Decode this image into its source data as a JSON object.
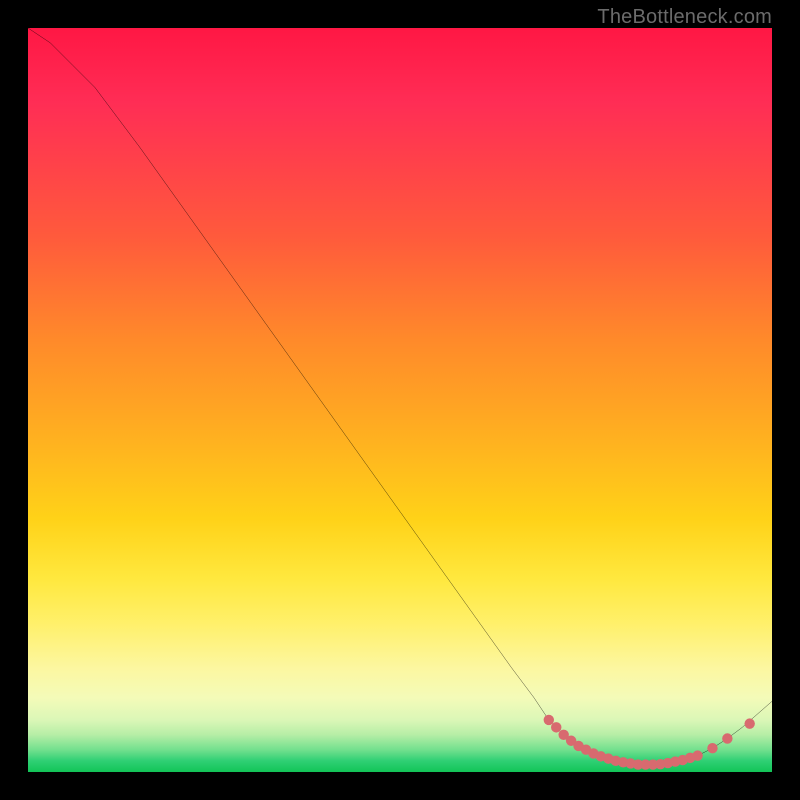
{
  "attribution": "TheBottleneck.com",
  "colors": {
    "frame": "#000000",
    "curve": "#000000",
    "marker": "#d86a6f",
    "gradient_top": "#ff1744",
    "gradient_bottom": "#12c457"
  },
  "chart_data": {
    "type": "line",
    "title": "",
    "xlabel": "",
    "ylabel": "",
    "xlim": [
      0,
      100
    ],
    "ylim": [
      0,
      100
    ],
    "grid": false,
    "legend": false,
    "series": [
      {
        "name": "bottleneck-curve",
        "x": [
          0,
          3,
          6,
          9,
          12,
          15,
          20,
          25,
          30,
          35,
          40,
          45,
          50,
          55,
          60,
          65,
          68,
          70,
          72,
          74,
          76,
          78,
          80,
          82,
          84,
          86,
          88,
          90,
          92,
          94,
          96,
          100
        ],
        "y": [
          100,
          98,
          95,
          92,
          88,
          84,
          77,
          70,
          63,
          56,
          49,
          42,
          35,
          28,
          21,
          14,
          10,
          7,
          5,
          3.5,
          2.5,
          1.8,
          1.3,
          1.0,
          1.0,
          1.2,
          1.6,
          2.2,
          3.2,
          4.5,
          6.0,
          9.5
        ]
      }
    ],
    "markers": {
      "name": "highlight-dots",
      "x": [
        70,
        71,
        72,
        73,
        74,
        75,
        76,
        77,
        78,
        79,
        80,
        81,
        82,
        83,
        84,
        85,
        86,
        87,
        88,
        89,
        90,
        92,
        94,
        97
      ],
      "y": [
        7.0,
        6.0,
        5.0,
        4.2,
        3.5,
        3.0,
        2.5,
        2.1,
        1.8,
        1.5,
        1.3,
        1.15,
        1.0,
        1.0,
        1.0,
        1.05,
        1.2,
        1.4,
        1.6,
        1.9,
        2.2,
        3.2,
        4.5,
        6.5
      ]
    }
  }
}
